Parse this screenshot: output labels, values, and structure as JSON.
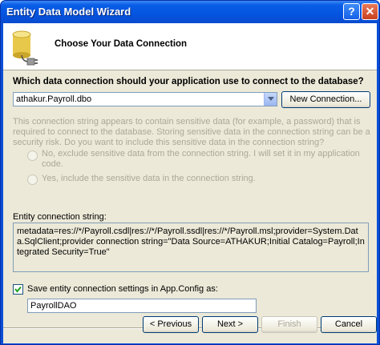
{
  "window": {
    "title": "Entity Data Model Wizard",
    "help_glyph": "?",
    "close_glyph": "✕"
  },
  "header": {
    "title": "Choose Your Data Connection",
    "icon": "database-plug-icon"
  },
  "connection": {
    "question": "Which data connection should your application use to connect to the database?",
    "selected": "athakur.Payroll.dbo",
    "new_connection_label": "New Connection..."
  },
  "sensitive": {
    "description": "This connection string appears to contain sensitive data (for example, a password) that is required to connect to the database. Storing sensitive data in the connection string can be a security risk. Do you want to include this sensitive data in the connection string?",
    "option_no_line1": "No, exclude sensitive data from the connection string. I will set it in my application",
    "option_no_line2": "code.",
    "option_yes": "Yes, include the sensitive data in the connection string."
  },
  "entity": {
    "label": "Entity connection string:",
    "value": "metadata=res://*/Payroll.csdl|res://*/Payroll.ssdl|res://*/Payroll.msl;provider=System.Data.SqlClient;provider connection string=\"Data Source=ATHAKUR;Initial Catalog=Payroll;Integrated Security=True\""
  },
  "save": {
    "checked": true,
    "label": "Save entity connection settings in App.Config as:",
    "value": "PayrollDAO"
  },
  "buttons": {
    "previous": "< Previous",
    "next": "Next >",
    "finish": "Finish",
    "cancel": "Cancel"
  }
}
